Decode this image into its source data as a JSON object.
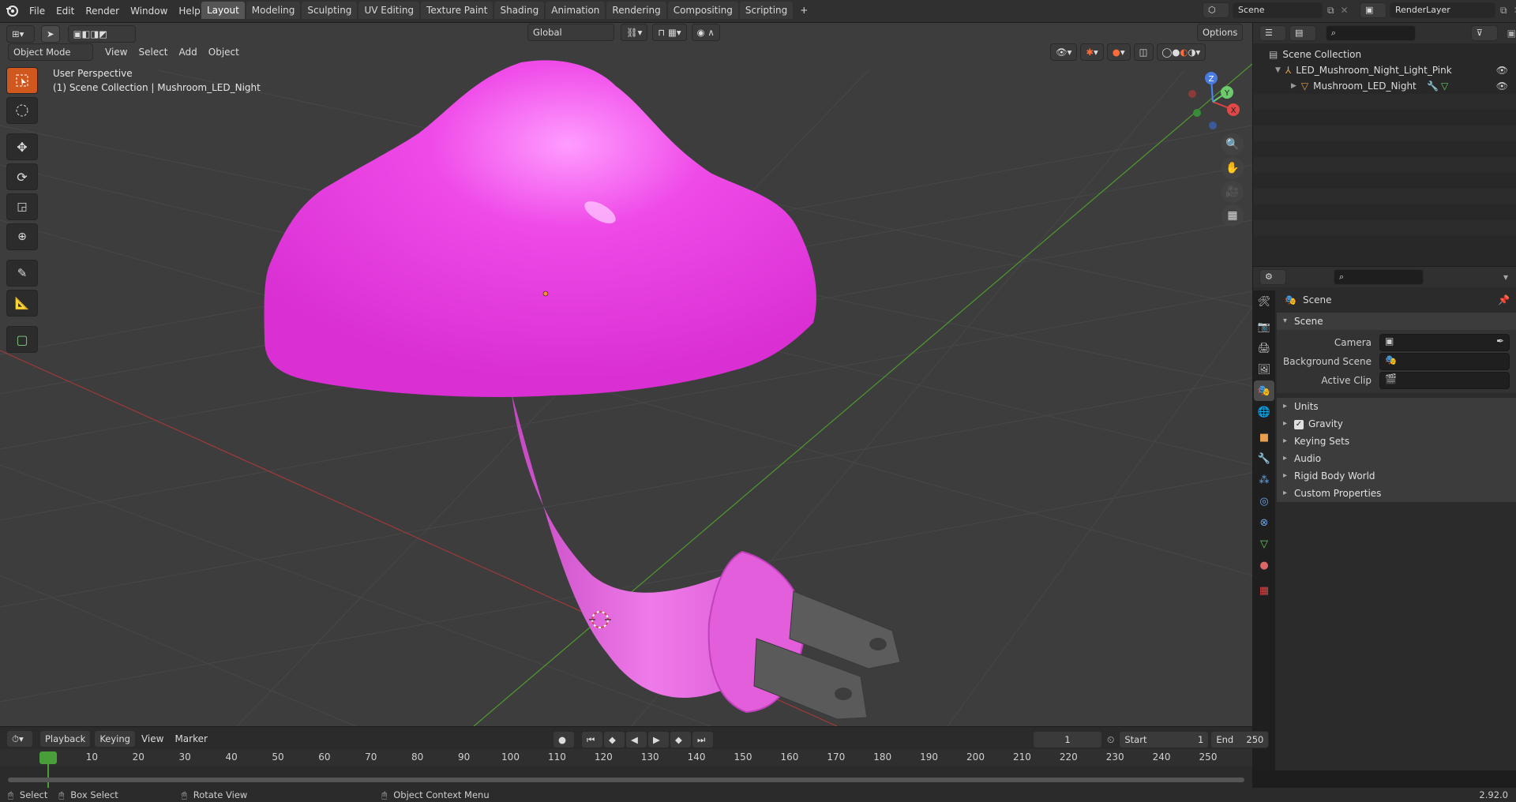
{
  "topbar": {
    "menu": [
      "File",
      "Edit",
      "Render",
      "Window",
      "Help"
    ],
    "workspaces": [
      "Layout",
      "Modeling",
      "Sculpting",
      "UV Editing",
      "Texture Paint",
      "Shading",
      "Animation",
      "Rendering",
      "Compositing",
      "Scripting"
    ],
    "active_workspace": "Layout",
    "add_tab": "+",
    "scene_name": "Scene",
    "view_layer": "RenderLayer"
  },
  "viewport": {
    "mode": "Object Mode",
    "menu": [
      "View",
      "Select",
      "Add",
      "Object"
    ],
    "transform_orientation": "Global",
    "options_label": "Options",
    "overlay_line1": "User Perspective",
    "overlay_line2": "(1) Scene Collection | Mushroom_LED_Night",
    "gizmo": {
      "x": "X",
      "y": "Y",
      "z": "Z"
    },
    "cap_color": "#ee3ee6",
    "stem_color": "#e55fe0"
  },
  "outliner": {
    "root": "Scene Collection",
    "items": [
      "LED_Mushroom_Night_Light_Pink",
      "Mushroom_LED_Night"
    ]
  },
  "properties": {
    "title": "Scene",
    "panel_scene": "Scene",
    "fields": [
      "Camera",
      "Background Scene",
      "Active Clip"
    ],
    "panels": [
      "Units",
      "Gravity",
      "Keying Sets",
      "Audio",
      "Rigid Body World",
      "Custom Properties"
    ],
    "gravity_checked": true
  },
  "timeline": {
    "menu": [
      "Playback",
      "Keying",
      "View",
      "Marker"
    ],
    "current_frame": "1",
    "start_label": "Start",
    "start": "1",
    "end_label": "End",
    "end": "250",
    "ticks": [
      "1",
      "10",
      "20",
      "30",
      "40",
      "50",
      "60",
      "70",
      "80",
      "90",
      "100",
      "110",
      "120",
      "130",
      "140",
      "150",
      "160",
      "170",
      "180",
      "190",
      "200",
      "210",
      "220",
      "230",
      "240",
      "250"
    ]
  },
  "status": {
    "items": [
      "Select",
      "Box Select",
      "Rotate View",
      "Object Context Menu"
    ],
    "version": "2.92.0"
  }
}
